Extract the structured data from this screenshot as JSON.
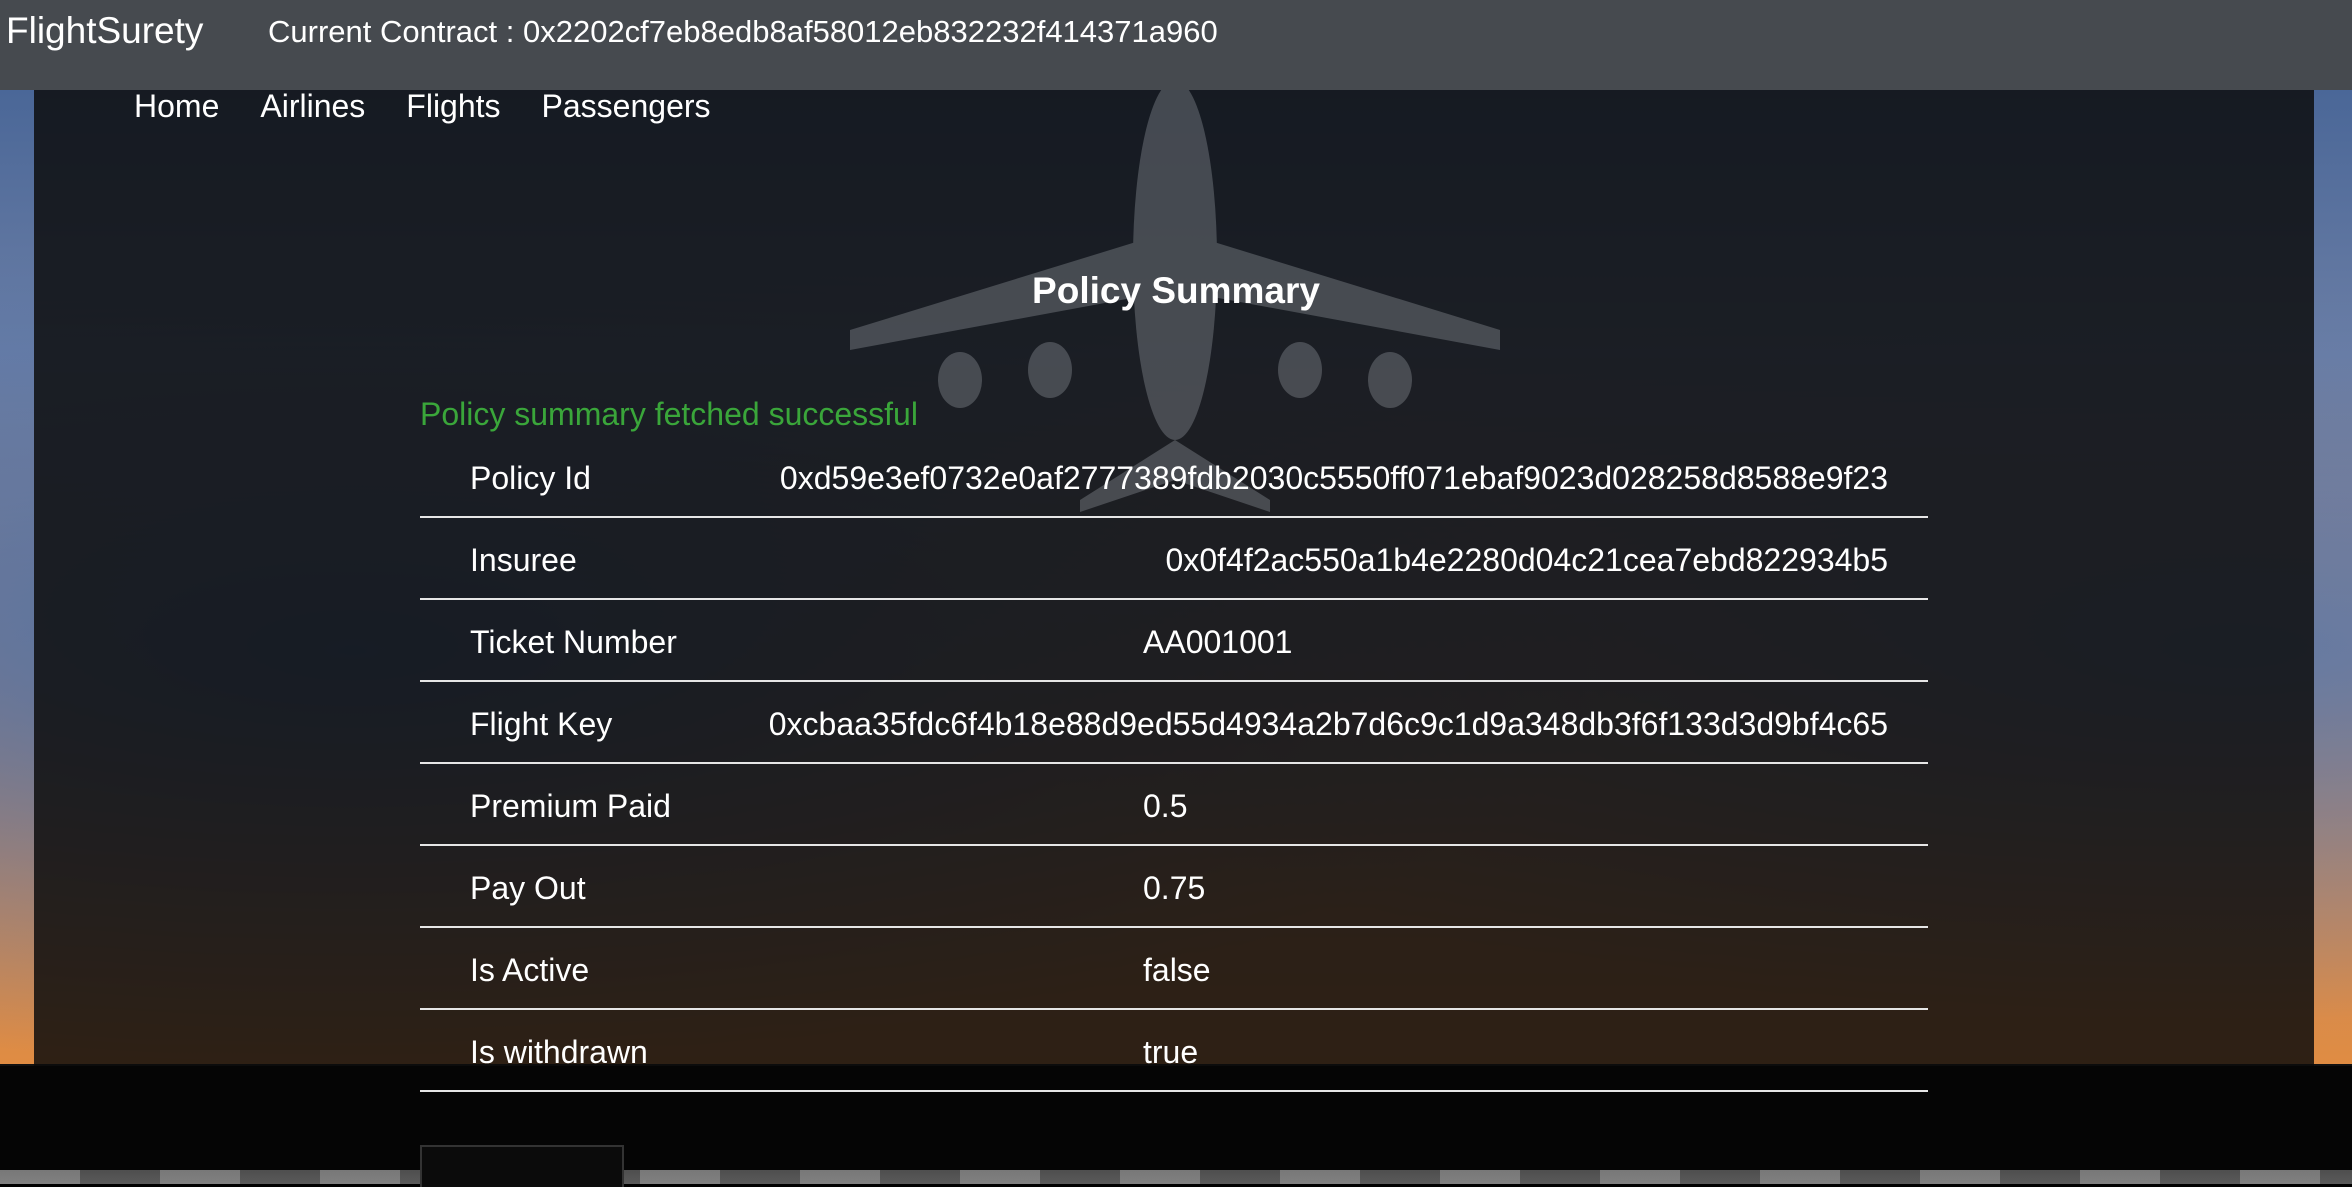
{
  "header": {
    "brand": "FlightSurety",
    "contract_text": "Current Contract : 0x2202cf7eb8edb8af58012eb832232f414371a960"
  },
  "nav": {
    "items": [
      {
        "label": "Home"
      },
      {
        "label": "Airlines"
      },
      {
        "label": "Flights"
      },
      {
        "label": "Passengers"
      }
    ]
  },
  "page": {
    "title": "Policy Summary",
    "status": "Policy summary fetched successful",
    "status_color": "#3aa63a"
  },
  "summary": {
    "rows": [
      {
        "label": "Policy Id",
        "value": "0xd59e3ef0732e0af2777389fdb2030c5550ff071ebaf9023d028258d8588e9f23"
      },
      {
        "label": "Insuree",
        "value": "0x0f4f2ac550a1b4e2280d04c21cea7ebd822934b5"
      },
      {
        "label": "Ticket Number",
        "value": "AA001001"
      },
      {
        "label": "Flight Key",
        "value": "0xcbaa35fdc6f4b18e88d9ed55d4934a2b7d6c9c1d9a348db3f6f133d3d9bf4c65"
      },
      {
        "label": "Premium Paid",
        "value": "0.5"
      },
      {
        "label": "Pay Out",
        "value": "0.75"
      },
      {
        "label": "Is Active",
        "value": "false"
      },
      {
        "label": "Is withdrawn",
        "value": "true"
      }
    ]
  }
}
